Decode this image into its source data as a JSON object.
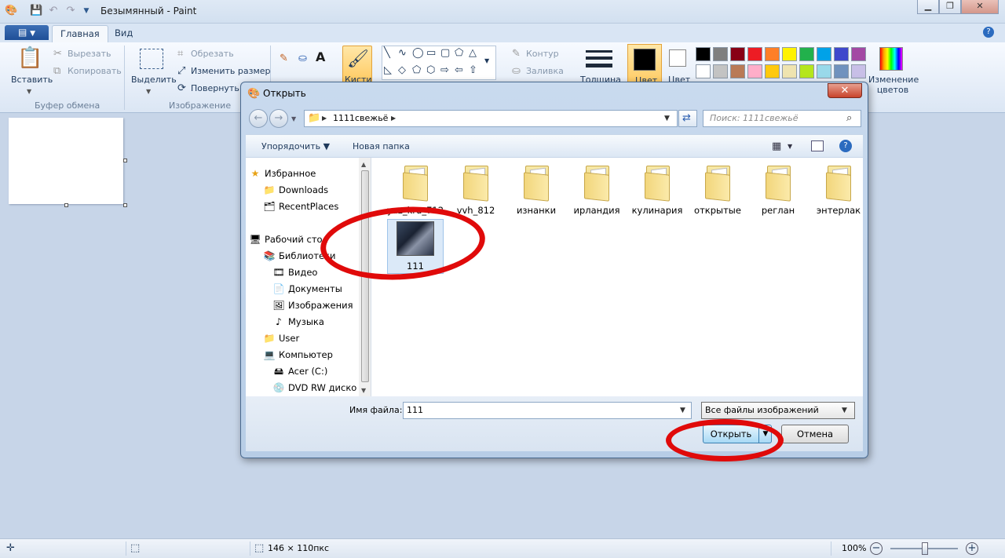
{
  "app": {
    "title": "Безымянный - Paint",
    "menu_button": "▼",
    "tabs": [
      "Главная",
      "Вид"
    ]
  },
  "ribbon": {
    "clipboard": {
      "paste": "Вставить",
      "cut": "Вырезать",
      "copy": "Копировать",
      "label": "Буфер обмена"
    },
    "image": {
      "select": "Выделить",
      "crop": "Обрезать",
      "resize": "Изменить размер",
      "rotate": "Повернуть",
      "label": "Изображение"
    },
    "brushes": "Кисти",
    "outline": "Контур",
    "fill": "Заливка",
    "thickness": "Толщина",
    "color1": "Цвет",
    "color2": "Цвет",
    "edit_colors": "Изменение цветов",
    "palette": [
      "#000000",
      "#7f7f7f",
      "#880015",
      "#ed1c24",
      "#ff7f27",
      "#fff200",
      "#22b14c",
      "#00a2e8",
      "#3f48cc",
      "#a349a4",
      "#ffffff",
      "#c3c3c3",
      "#b97a57",
      "#ffaec9",
      "#ffc90e",
      "#efe4b0",
      "#b5e61d",
      "#99d9ea",
      "#7092be",
      "#c8bfe7"
    ]
  },
  "dialog": {
    "title": "Открыть",
    "close": "✕",
    "path": "1111свежьё",
    "search_placeholder": "Поиск: 1111свежьё",
    "toolbar": {
      "organize": "Упорядочить ▼",
      "new_folder": "Новая папка"
    },
    "nav": [
      {
        "label": "Избранное",
        "icon": "star-icon"
      },
      {
        "label": "Downloads",
        "icon": "downloads-folder-icon"
      },
      {
        "label": "RecentPlaces",
        "icon": "recent-places-icon"
      },
      {
        "label": "Рабочий стол",
        "icon": "desktop-icon"
      },
      {
        "label": "Библиотеки",
        "icon": "libraries-icon"
      },
      {
        "label": "Видео",
        "icon": "video-icon"
      },
      {
        "label": "Документы",
        "icon": "documents-icon"
      },
      {
        "label": "Изображения",
        "icon": "pictures-icon"
      },
      {
        "label": "Музыка",
        "icon": "music-icon"
      },
      {
        "label": "User",
        "icon": "user-folder-icon"
      },
      {
        "label": "Компьютер",
        "icon": "computer-icon"
      },
      {
        "label": "Acer (C:)",
        "icon": "drive-icon"
      },
      {
        "label": "DVD RW диско",
        "icon": "dvd-drive-icon"
      }
    ],
    "files": [
      {
        "name": "yaz_kru_712",
        "type": "folder"
      },
      {
        "name": "vvh_812",
        "type": "folder"
      },
      {
        "name": "изнанки",
        "type": "folder"
      },
      {
        "name": "ирландия",
        "type": "folder"
      },
      {
        "name": "кулинария",
        "type": "folder"
      },
      {
        "name": "открытые",
        "type": "folder"
      },
      {
        "name": "реглан",
        "type": "folder"
      },
      {
        "name": "энтерлак",
        "type": "folder"
      },
      {
        "name": "111",
        "type": "image"
      }
    ],
    "filename_label": "Имя файла:",
    "filename_value": "111",
    "filetype_value": "Все файлы изображений",
    "open_button": "Открыть",
    "cancel_button": "Отмена"
  },
  "status": {
    "canvas_size": "146 × 110пкс",
    "zoom": "100%"
  }
}
